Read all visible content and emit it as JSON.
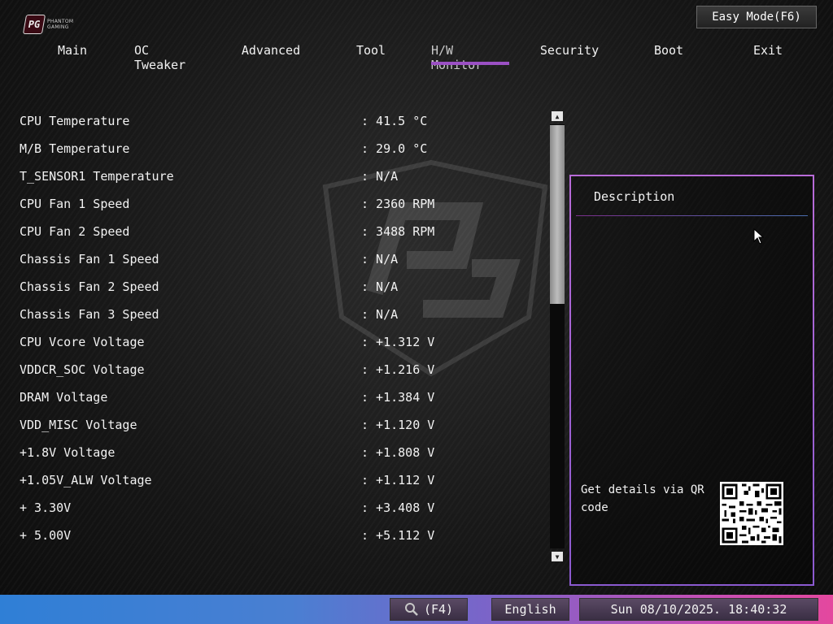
{
  "brand": {
    "mark": "PG",
    "line1": "PHANTOM",
    "line2": "GAMING"
  },
  "header": {
    "easy_mode": "Easy Mode(F6)"
  },
  "nav": {
    "tabs": [
      {
        "label": "Main"
      },
      {
        "label": "OC Tweaker"
      },
      {
        "label": "Advanced"
      },
      {
        "label": "Tool"
      },
      {
        "label": "H/W Monitor",
        "active": true
      },
      {
        "label": "Security"
      },
      {
        "label": "Boot"
      },
      {
        "label": "Exit"
      }
    ]
  },
  "monitor": {
    "rows": [
      {
        "label": "CPU Temperature",
        "value": ": 41.5 °C"
      },
      {
        "label": "M/B Temperature",
        "value": ": 29.0 °C"
      },
      {
        "label": "T_SENSOR1 Temperature",
        "value": ": N/A"
      },
      {
        "label": "CPU Fan 1 Speed",
        "value": ": 2360 RPM"
      },
      {
        "label": "CPU Fan 2 Speed",
        "value": ": 3488 RPM"
      },
      {
        "label": "Chassis Fan 1 Speed",
        "value": ": N/A"
      },
      {
        "label": "Chassis Fan 2 Speed",
        "value": ": N/A"
      },
      {
        "label": "Chassis Fan 3 Speed",
        "value": ": N/A"
      },
      {
        "label": "CPU Vcore Voltage",
        "value": ": +1.312 V"
      },
      {
        "label": "VDDCR_SOC Voltage",
        "value": ": +1.216 V"
      },
      {
        "label": "DRAM Voltage",
        "value": ": +1.384 V"
      },
      {
        "label": "VDD_MISC Voltage",
        "value": ": +1.120 V"
      },
      {
        "label": "+1.8V Voltage",
        "value": ": +1.808 V"
      },
      {
        "label": "+1.05V_ALW Voltage",
        "value": ": +1.112 V"
      },
      {
        "label": "+ 3.30V",
        "value": ": +3.408 V"
      },
      {
        "label": "+ 5.00V",
        "value": ": +5.112 V"
      }
    ]
  },
  "description": {
    "title": "Description",
    "qr_text": "Get details via QR code"
  },
  "footer": {
    "search": "(F4)",
    "language": "English",
    "datetime": "Sun 08/10/2025. 18:40:32"
  },
  "colors": {
    "accent": "#9b50c4",
    "panel_border": "#b86bd8"
  }
}
